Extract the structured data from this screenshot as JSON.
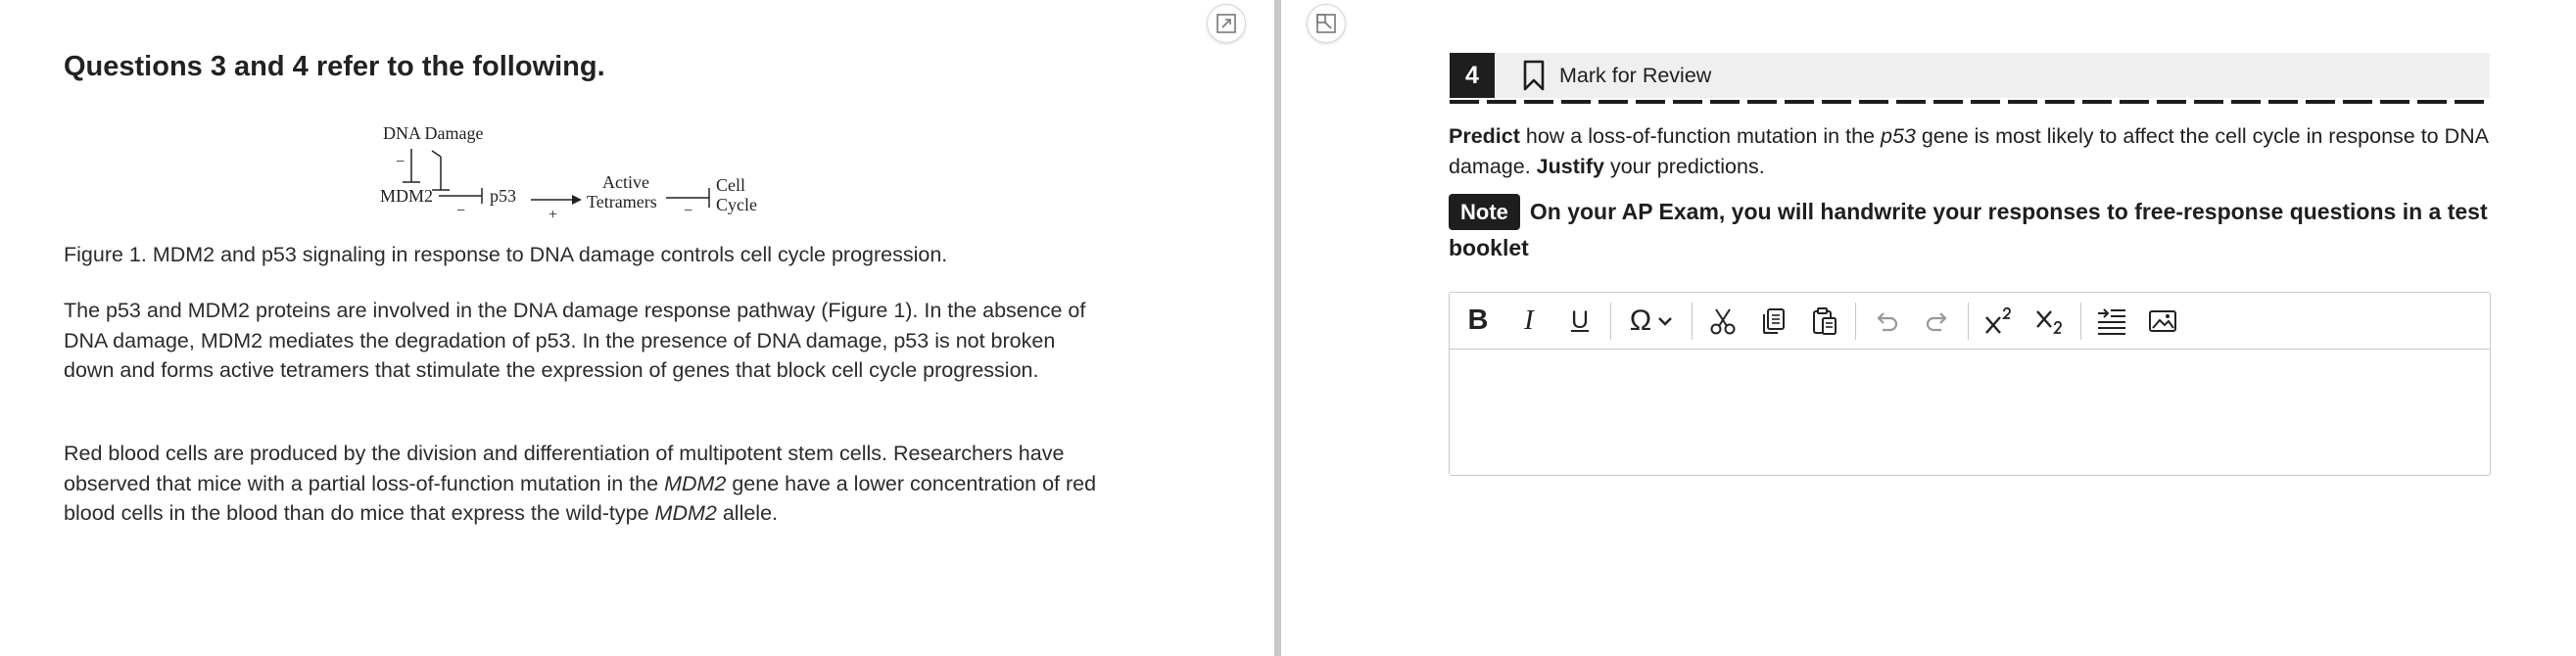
{
  "passage": {
    "heading": "Questions 3 and 4 refer to the following.",
    "figure": {
      "dna_damage": "DNA Damage",
      "mdm2": "MDM2",
      "p53": "p53",
      "active": "Active",
      "tetramers": "Tetramers",
      "cell": "Cell",
      "cycle": "Cycle",
      "minus": "−",
      "plus": "+"
    },
    "caption": "Figure 1. MDM2 and p53 signaling in response to DNA damage controls cell cycle progression.",
    "para1": "The p53 and MDM2 proteins are involved in the DNA damage response pathway (Figure 1). In the absence of DNA damage, MDM2 mediates the degradation of p53. In the presence of DNA damage, p53 is not broken down and forms active tetramers that stimulate the expression of genes that block cell cycle progression.",
    "para2": {
      "t1": "Red blood cells are produced by the division and differentiation of multipotent stem cells. Researchers have observed that mice with a partial loss-of-function mutation in the ",
      "em1": "MDM2",
      "t2": " gene have a lower concentration of red blood cells in the blood than do mice that express the wild-type ",
      "em2": "MDM2",
      "t3": " allele."
    }
  },
  "pane_controls": {
    "expand_icon": "expand-icon",
    "collapse_icon": "collapse-icon"
  },
  "question": {
    "number": "4",
    "mark_for_review": "Mark for Review",
    "prompt": {
      "b1": "Predict",
      "t1": " how a loss-of-function mutation in the ",
      "em": "p53",
      "t2": " gene is most likely to affect the cell cycle in response to DNA damage. ",
      "b2": "Justify",
      "t3": " your predictions."
    },
    "note_badge": "Note",
    "note_text": "On your AP Exam, you will handwrite your responses to free-response questions in a test booklet"
  },
  "toolbar": {
    "bold": "B",
    "italic": "I",
    "underline": "U",
    "omega": "Ω",
    "icons": [
      "bold-icon",
      "italic-icon",
      "underline-icon",
      "special-characters-icon",
      "cut-icon",
      "copy-icon",
      "paste-icon",
      "undo-icon",
      "redo-icon",
      "superscript-icon",
      "subscript-icon",
      "indent-icon",
      "image-icon"
    ]
  },
  "colors": {
    "dark": "#1e1e1e",
    "header_bg": "#efefef",
    "divider": "#c9c9c9",
    "border": "#c8c8c8"
  }
}
